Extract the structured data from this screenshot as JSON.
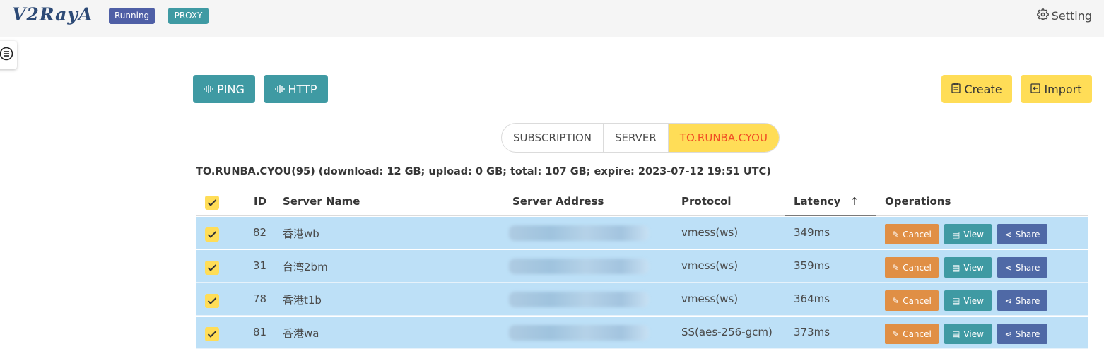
{
  "navbar": {
    "logo": "V2RayA",
    "status_tag": "Running",
    "mode_tag": "PROXY",
    "setting_label": "Setting"
  },
  "toolbar": {
    "ping_label": "PING",
    "http_label": "HTTP",
    "create_label": "Create",
    "import_label": "Import"
  },
  "tabs": [
    {
      "label": "SUBSCRIPTION",
      "active": false
    },
    {
      "label": "SERVER",
      "active": false
    },
    {
      "label": "TO.RUNBA.CYOU",
      "active": true
    }
  ],
  "subscription_info": "TO.RUNBA.CYOU(95) (download: 12 GB; upload: 0 GB; total: 107 GB; expire: 2023-07-12 19:51 UTC)",
  "table": {
    "columns": {
      "id": "ID",
      "name": "Server Name",
      "address": "Server Address",
      "protocol": "Protocol",
      "latency": "Latency",
      "operations": "Operations"
    },
    "sort_indicator": "↑",
    "rows": [
      {
        "id": "82",
        "name": "香港wb",
        "protocol": "vmess(ws)",
        "latency": "349ms"
      },
      {
        "id": "31",
        "name": "台湾2bm",
        "protocol": "vmess(ws)",
        "latency": "359ms"
      },
      {
        "id": "78",
        "name": "香港t1b",
        "protocol": "vmess(ws)",
        "latency": "364ms"
      },
      {
        "id": "81",
        "name": "香港wa",
        "protocol": "SS(aes-256-gcm)",
        "latency": "373ms"
      }
    ],
    "actions": {
      "cancel_label": "Cancel",
      "view_label": "View",
      "share_label": "Share"
    }
  },
  "colors": {
    "teal": "#3f9aa3",
    "yellow": "#ffdd57",
    "selected_row": "#bde0f7",
    "cancel": "#e08f45",
    "share": "#4f69a6"
  }
}
